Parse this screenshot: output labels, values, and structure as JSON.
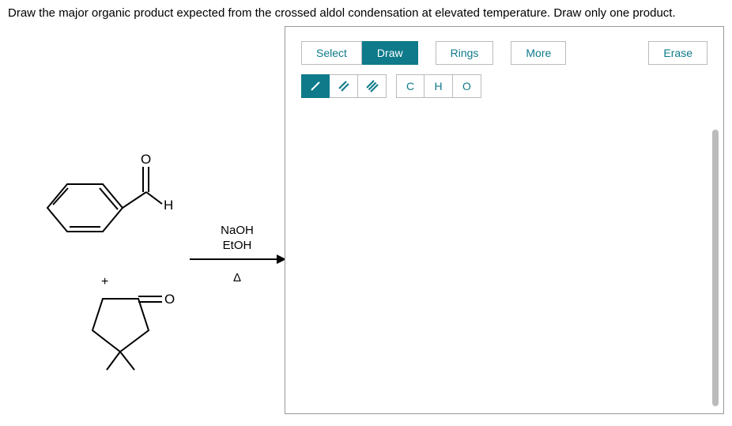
{
  "question": "Draw the major organic product expected from the crossed aldol condensation at elevated temperature. Draw only one product.",
  "reaction": {
    "plus": "+",
    "reagent1": "NaOH",
    "reagent2": "EtOH",
    "condition": "Δ",
    "aldehyde_H": "H",
    "aldehyde_O": "O",
    "ketone_O": "O"
  },
  "toolbar": {
    "select": "Select",
    "draw": "Draw",
    "rings": "Rings",
    "more": "More",
    "erase": "Erase",
    "bonds": {
      "single": "/",
      "double": "//",
      "triple": "///"
    },
    "elements": {
      "c": "C",
      "h": "H",
      "o": "O"
    }
  }
}
